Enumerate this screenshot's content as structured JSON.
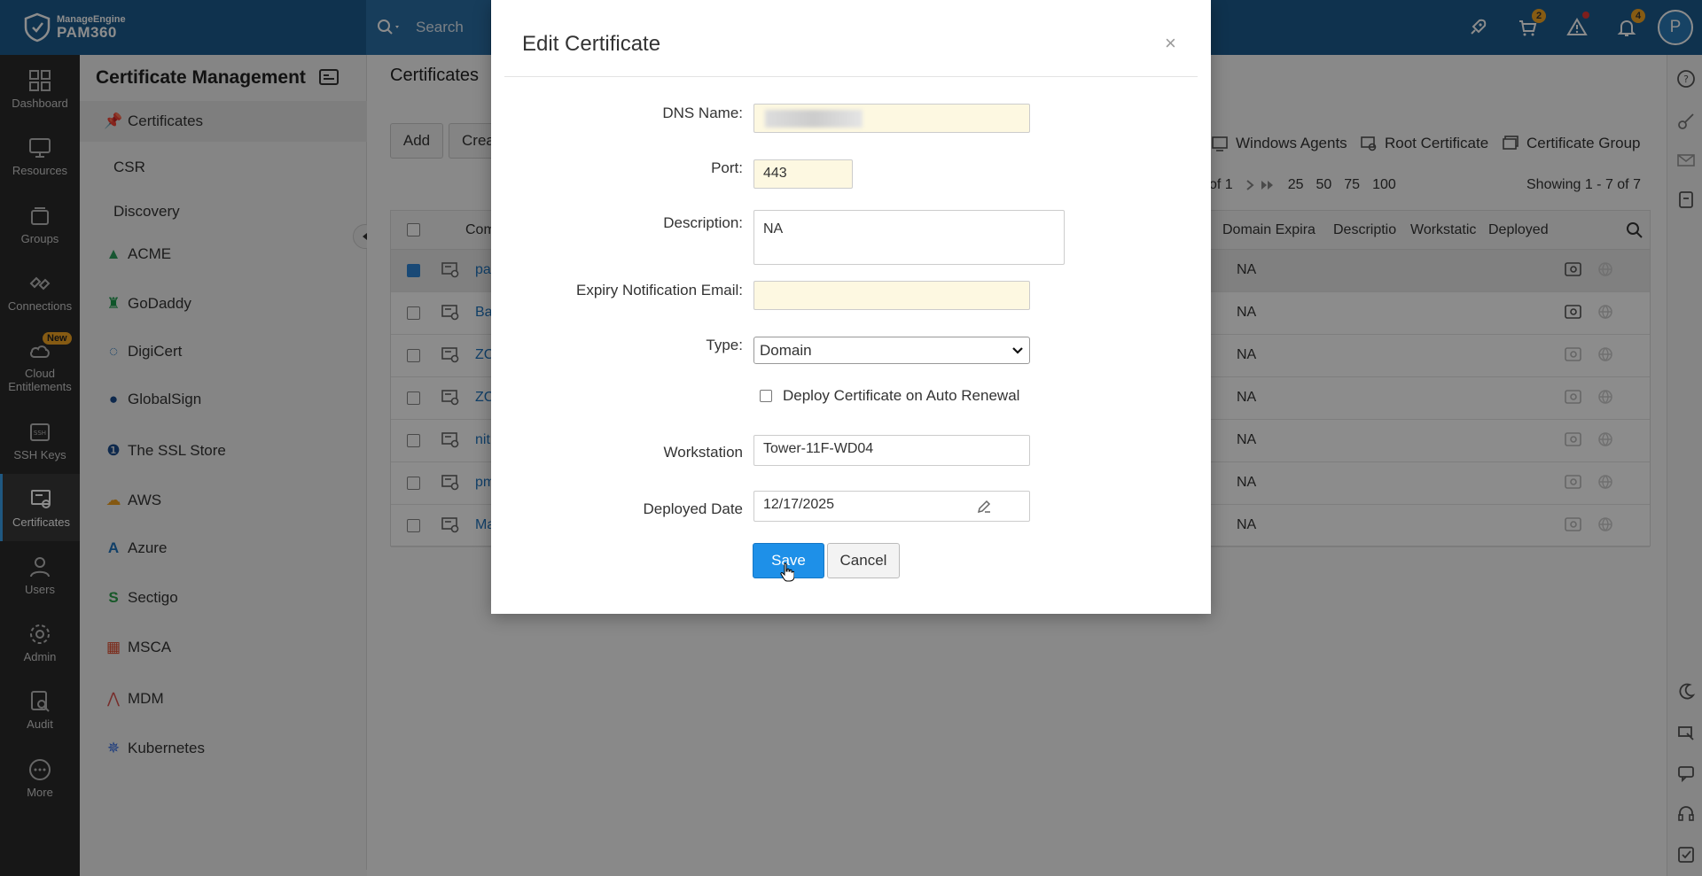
{
  "topbar": {
    "brand": "ManageEngine",
    "product": "PAM360",
    "search_label": "Search",
    "cart_badge": "2",
    "notif_badge": "4",
    "avatar_letter": "P"
  },
  "rail": [
    {
      "label": "Dashboard",
      "icon": "dashboard-icon"
    },
    {
      "label": "Resources",
      "icon": "monitor-icon"
    },
    {
      "label": "Groups",
      "icon": "groups-icon"
    },
    {
      "label": "Connections",
      "icon": "connections-icon"
    },
    {
      "label": "Cloud",
      "label2": "Entitlements",
      "icon": "cloud-icon",
      "badge": "New"
    },
    {
      "label": "SSH Keys",
      "icon": "ssh-icon"
    },
    {
      "label": "Certificates",
      "icon": "certificate-icon",
      "active": true
    },
    {
      "label": "Users",
      "icon": "user-icon"
    },
    {
      "label": "Admin",
      "icon": "gear-icon"
    },
    {
      "label": "Audit",
      "icon": "audit-icon"
    },
    {
      "label": "More",
      "icon": "more-icon"
    }
  ],
  "subnav": {
    "title": "Certificate Management",
    "items": [
      "Certificates",
      "CSR",
      "Discovery",
      "ACME",
      "GoDaddy",
      "DigiCert",
      "GlobalSign",
      "The SSL Store",
      "AWS",
      "Azure",
      "Sectigo",
      "MSCA",
      "MDM",
      "Kubernetes"
    ]
  },
  "main": {
    "title": "Certificates",
    "add_label": "Add",
    "create_label": "Crea",
    "links": [
      "Windows Agents",
      "Root Certificate",
      "Certificate Group"
    ],
    "pager": {
      "of": "of 1",
      "sizes": [
        "25",
        "50",
        "75",
        "100"
      ],
      "showing": "Showing 1 - 7 of 7"
    },
    "columns": [
      "Com",
      "Domain Expira",
      "Descriptio",
      "Workstatic",
      "Deployed"
    ],
    "rows": [
      {
        "name": "pa",
        "value": "NA",
        "checked": true
      },
      {
        "name": "Ba",
        "value": "NA"
      },
      {
        "name": "ZC",
        "value": "NA"
      },
      {
        "name": "ZC",
        "value": "NA"
      },
      {
        "name": "nit",
        "value": "NA"
      },
      {
        "name": "pm",
        "value": "NA"
      },
      {
        "name": "Ma",
        "value": "NA"
      }
    ]
  },
  "modal": {
    "title": "Edit Certificate",
    "close": "×",
    "dns_label": "DNS Name:",
    "port_label": "Port:",
    "port_value": "443",
    "desc_label": "Description:",
    "desc_value": "NA",
    "email_label": "Expiry Notification Email:",
    "email_value": "",
    "type_label": "Type:",
    "type_value": "Domain",
    "autorenew_label": "Deploy Certificate on Auto Renewal",
    "workstation_label": "Workstation",
    "workstation_value": "Tower-11F-WD04",
    "date_label": "Deployed Date",
    "date_value": "12/17/2025",
    "save_label": "Save",
    "cancel_label": "Cancel"
  },
  "colors": {
    "topbar": "#1c5c8f",
    "accent": "#1e90e8",
    "rail": "#2b2b2b"
  }
}
